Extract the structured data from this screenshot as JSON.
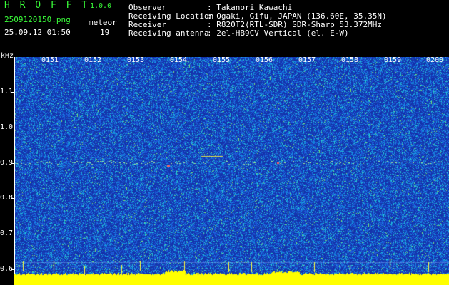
{
  "header": {
    "app_name": "H R O F F T",
    "version": "1.0.0",
    "filename": "2509120150.png",
    "label_meteor": "meteor",
    "datetime": "25.09.12 01:50",
    "meteor_count": "19"
  },
  "info": [
    {
      "key": "Observer",
      "value": ": Takanori Kawachi"
    },
    {
      "key": "Receiving Location",
      "value": ": Ogaki, Gifu, JAPAN (136.60E, 35.35N)"
    },
    {
      "key": "Receiver",
      "value": ": R820T2(RTL-SDR) SDR-Sharp 53.372MHz"
    },
    {
      "key": "Receiving antenna",
      "value": ": 2el-HB9CV Vertical (el. E-W)"
    }
  ],
  "axis": {
    "unit": "kHz",
    "y_labels": [
      "1.1",
      "1.0",
      "0.9",
      "0.8",
      "0.7",
      "0.6"
    ],
    "x_labels": [
      "0151",
      "0152",
      "0153",
      "0154",
      "0155",
      "0156",
      "0157",
      "0158",
      "0159",
      "0200"
    ]
  },
  "colors": {
    "background": "#000000",
    "header_green": "#39ff39",
    "spectrum_base": "#1a3fb0",
    "noise_floor": "#ffff00"
  }
}
